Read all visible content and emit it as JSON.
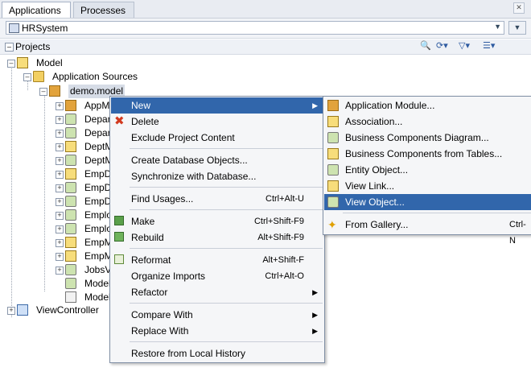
{
  "tabs": [
    {
      "label": "Applications",
      "active": true
    },
    {
      "label": "Processes",
      "active": false
    }
  ],
  "app_selector": {
    "value": "HRSystem"
  },
  "projects_panel": {
    "title": "Projects"
  },
  "tree": {
    "model": "Model",
    "application_sources": "Application Sources",
    "package": "demo.model",
    "children": [
      "AppM",
      "Depar",
      "Depar",
      "DeptM",
      "DeptM",
      "EmpDe",
      "EmpDe",
      "EmpDe",
      "Emplo",
      "Emplo",
      "EmpM",
      "EmpM",
      "JobsV",
      "Model",
      "Model"
    ],
    "view_controller": "ViewController"
  },
  "context_menu": {
    "items": [
      {
        "label": "New",
        "has_submenu": true,
        "highlighted": true
      },
      {
        "label": "Delete"
      },
      {
        "label": "Exclude Project Content"
      },
      {
        "label": "Create Database Objects..."
      },
      {
        "label": "Synchronize with Database..."
      },
      {
        "label": "Find Usages...",
        "shortcut": "Ctrl+Alt-U"
      },
      {
        "label": "Make",
        "shortcut": "Ctrl+Shift-F9"
      },
      {
        "label": "Rebuild",
        "shortcut": "Alt+Shift-F9"
      },
      {
        "label": "Reformat",
        "shortcut": "Alt+Shift-F"
      },
      {
        "label": "Organize Imports",
        "shortcut": "Ctrl+Alt-O"
      },
      {
        "label": "Refactor",
        "has_submenu": true
      },
      {
        "label": "Compare With",
        "has_submenu": true
      },
      {
        "label": "Replace With",
        "has_submenu": true
      },
      {
        "label": "Restore from Local History"
      }
    ]
  },
  "submenu": {
    "items": [
      {
        "label": "Application Module..."
      },
      {
        "label": "Association..."
      },
      {
        "label": "Business Components Diagram..."
      },
      {
        "label": "Business Components from Tables..."
      },
      {
        "label": "Entity Object..."
      },
      {
        "label": "View Link..."
      },
      {
        "label": "View Object...",
        "highlighted": true
      },
      {
        "label": "From Gallery...",
        "shortcut": "Ctrl-N"
      }
    ]
  },
  "colors": {
    "highlight": "#3166ab",
    "menu_bg": "#f5f6f8",
    "tab_bar": "#e9ecf2"
  }
}
